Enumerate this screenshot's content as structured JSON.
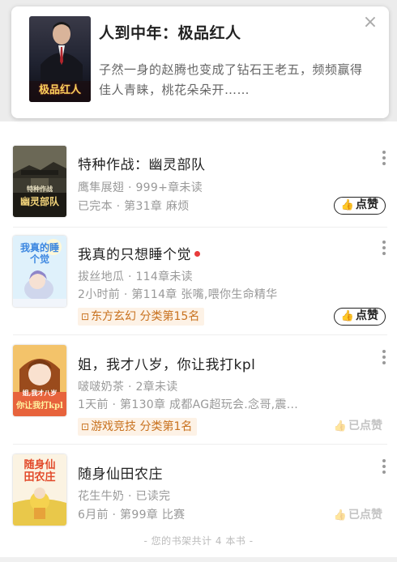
{
  "recommend": {
    "title": "人到中年：极品红人",
    "description": "子然一身的赵腾也变成了钻石王老五，频频赢得佳人青睐，桃花朵朵开……",
    "cover_text": "极品红人",
    "close_icon": "close-icon"
  },
  "books": [
    {
      "title": "特种作战：幽灵部队",
      "author_line": "鹰隼展翅 · 999+章未读",
      "update_line": "已完本 · 第31章 麻烦",
      "cover_text": "幽灵部队",
      "cover_subtext": "特种作战",
      "has_red_dot": false,
      "tag": "",
      "like_label": "点赞",
      "liked": false
    },
    {
      "title": "我真的只想睡个觉",
      "author_line": "拔丝地瓜 · 114章未读",
      "update_line": "2小时前 · 第114章 张嘴,喂你生命精华",
      "cover_text": "我真的睡个觉",
      "cover_subtext": "",
      "has_red_dot": true,
      "tag": "东方玄幻 分类第15名",
      "like_label": "点赞",
      "liked": false
    },
    {
      "title": "姐，我才八岁，你让我打kpl",
      "author_line": "啵啵奶茶 · 2章未读",
      "update_line": "1天前 · 第130章 成都AG超玩会.念哥,震...",
      "cover_text": "你让我打kpl",
      "cover_subtext": "姐,我才八岁",
      "has_red_dot": false,
      "tag": "游戏竞技 分类第1名",
      "like_label": "已点赞",
      "liked": true
    },
    {
      "title": "随身仙田农庄",
      "author_line": "花生牛奶 · 已读完",
      "update_line": "6月前 · 第99章 比赛",
      "cover_text": "随身仙田农庄",
      "cover_subtext": "",
      "has_red_dot": false,
      "tag": "",
      "like_label": "已点赞",
      "liked": true
    }
  ],
  "footer": "- 您的书架共计 4 本书 -",
  "colors": {
    "tag_bg": "#fdf2e6",
    "tag_text": "#c8711e",
    "red_dot": "#e83b3b",
    "liked_text": "#c4c4c4"
  }
}
